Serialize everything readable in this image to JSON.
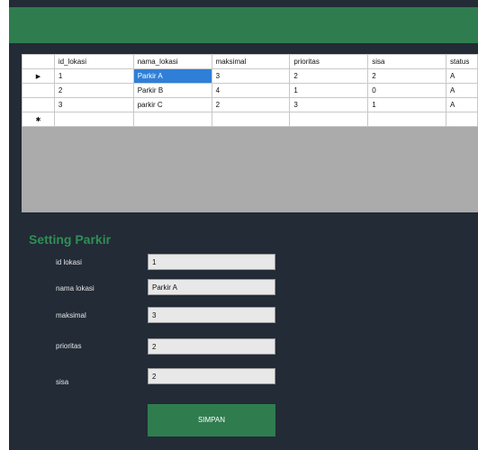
{
  "grid": {
    "columns": [
      "id_lokasi",
      "nama_lokasi",
      "maksimal",
      "prioritas",
      "sisa",
      "status"
    ],
    "rows": [
      [
        "1",
        "Parkir A",
        "3",
        "2",
        "2",
        "A"
      ],
      [
        "2",
        "Parkir B",
        "4",
        "1",
        "0",
        "A"
      ],
      [
        "3",
        "parkir C",
        "2",
        "3",
        "1",
        "A"
      ]
    ],
    "current_row_marker": "▶",
    "new_row_marker": "✱"
  },
  "form": {
    "title": "Setting Parkir",
    "fields": [
      {
        "label": "id lokasi",
        "value": "1"
      },
      {
        "label": "nama lokasi",
        "value": "Parkir A"
      },
      {
        "label": "maksimal",
        "value": "3"
      },
      {
        "label": "prioritas",
        "value": "2"
      },
      {
        "label": "sisa",
        "value": "2"
      }
    ],
    "save_label": "SIMPAN"
  },
  "colors": {
    "header_bar": "#2f7d4f",
    "window_bg": "#222b36",
    "title_text": "#2f8f55",
    "selection": "#2f7fd8"
  }
}
